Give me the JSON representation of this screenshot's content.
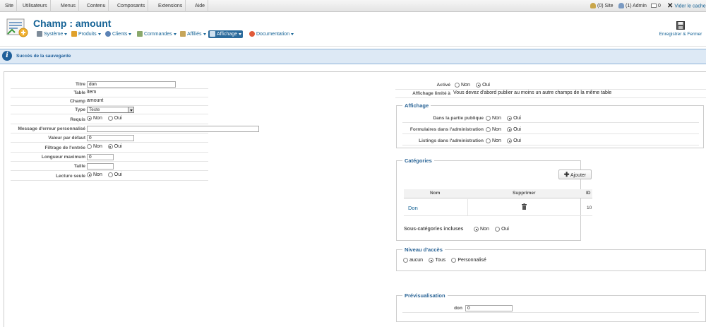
{
  "topmenu": [
    "Site",
    "Utilisateurs",
    "Menus",
    "Contenu",
    "Composants",
    "Extensions",
    "Aide"
  ],
  "status": {
    "site": "(0) Site",
    "admin": "(1) Admin",
    "count": "0",
    "clear_cache": "Vider le cache"
  },
  "header": {
    "title": "Champ : amount",
    "submenu": [
      "Système",
      "Produits",
      "Clients",
      "Commandes",
      "Affiliés",
      "Affichage",
      "Documentation"
    ],
    "save_label": "Enregistrer & Fermer"
  },
  "message": "Succès de la sauvegarde",
  "form": {
    "titre_label": "Titre",
    "titre_value": "don",
    "table_label": "Table",
    "table_value": "item",
    "champ_label": "Champ",
    "champ_value": "amount",
    "type_label": "Type",
    "type_value": "Texte",
    "requis_label": "Requis",
    "message_label": "Message d'erreur personnalisé",
    "default_label": "Valeur par défaut",
    "default_value": "0",
    "filtrage_label": "Filtrage de l'entrée",
    "longueur_label": "Longueur maximum",
    "longueur_value": "0",
    "taille_label": "Taille",
    "lecture_label": "Lecture seule"
  },
  "radio": {
    "non": "Non",
    "oui": "Oui"
  },
  "right": {
    "active_label": "Activé",
    "affichage_limite_label": "Affichage limité à",
    "affichage_limite_value": "Vous devez d'abord publier au moins un autre champs de la même table",
    "affichage_legend": "Affichage",
    "public_label": "Dans la partie publique",
    "forms_admin_label": "Formulaires dans l'administration",
    "listings_admin_label": "Listings dans l'administration",
    "categories_legend": "Catégories",
    "add_label": "Ajouter",
    "col_nom": "Nom",
    "col_supprimer": "Supprimer",
    "col_id": "ID",
    "cat_name": "Don",
    "cat_id": "10",
    "subcat_label": "Sous-catégories incluses",
    "access_legend": "Niveau d'accès",
    "access_aucun": "aucun",
    "access_tous": "Tous",
    "access_perso": "Personnalisé",
    "preview_legend": "Prévisualisation",
    "preview_label": "don",
    "preview_value": "0"
  }
}
